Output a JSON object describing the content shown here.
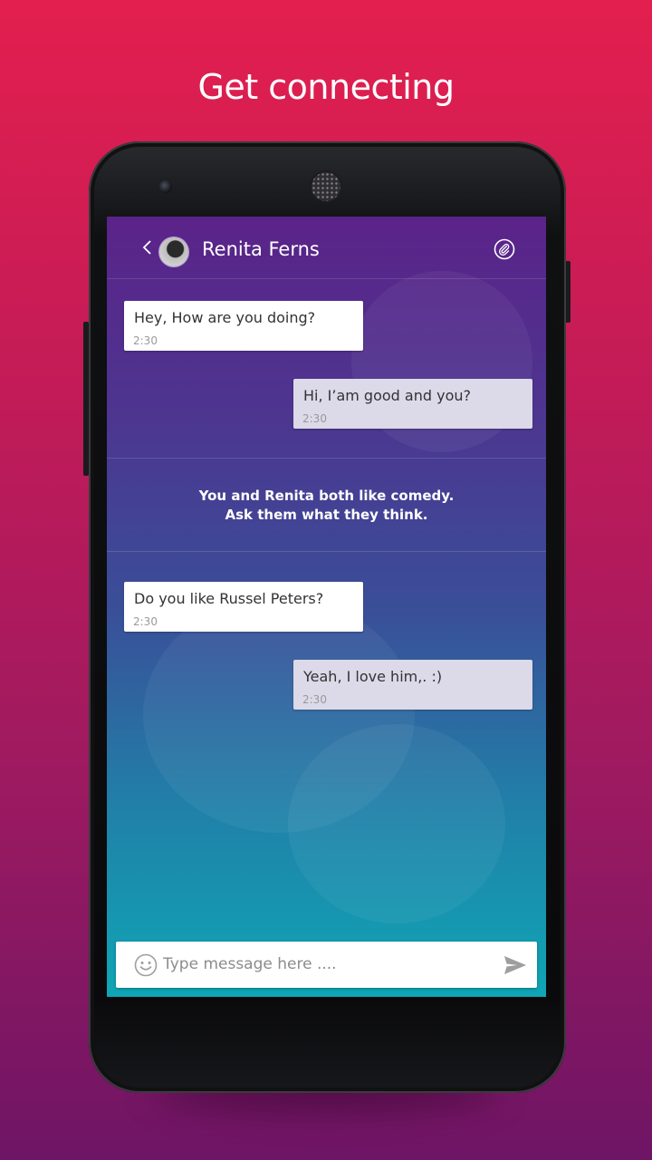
{
  "headline": "Get connecting",
  "colors": {
    "background_top": "#e31f4e",
    "background_bottom": "#6e1565",
    "screen_top": "#5b2389",
    "screen_bottom": "#0fa6b5",
    "outgoing_bubble": "#dcd9e9",
    "incoming_bubble": "#ffffff"
  },
  "chat": {
    "contact_name": "Renita Ferns",
    "back_icon": "chevron-left-icon",
    "attach_icon": "paperclip-icon",
    "messages": [
      {
        "direction": "incoming",
        "text": "Hey, How are you doing?",
        "time": "2:30"
      },
      {
        "direction": "outgoing",
        "text": "Hi, I’am good and you?",
        "time": "2:30"
      },
      {
        "direction": "incoming",
        "text": "Do you like Russel Peters?",
        "time": "2:30"
      },
      {
        "direction": "outgoing",
        "text": "Yeah, I love him,. :)",
        "time": "2:30"
      }
    ],
    "notice": {
      "line1": "You and Renita both like comedy.",
      "line2": "Ask them what they think."
    }
  },
  "composer": {
    "placeholder": "Type message here ....",
    "value": "",
    "emoji_icon": "smiley-icon",
    "send_icon": "send-icon"
  }
}
